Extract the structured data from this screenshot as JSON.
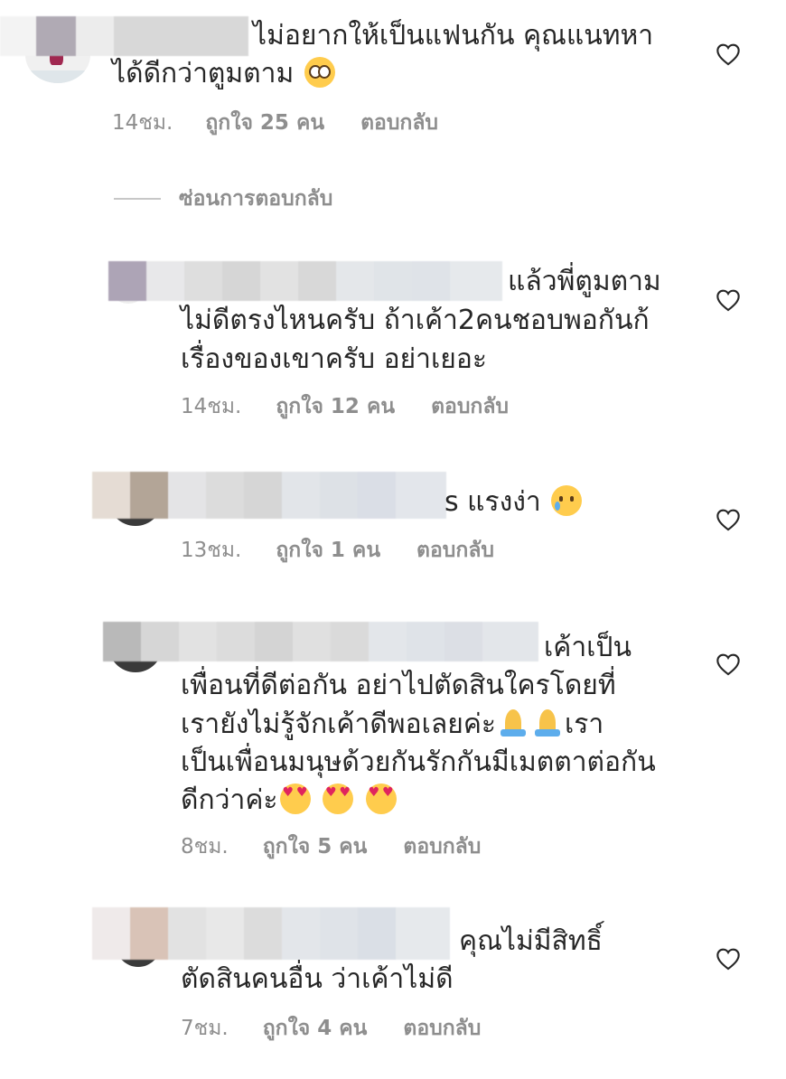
{
  "ui": {
    "likes_word": "ถูกใจ",
    "people_word": "คน",
    "reply_label": "ตอบกลับ",
    "hide_replies_label": "ซ่อนการตอบกลับ"
  },
  "comments": [
    {
      "line1": "ไม่อยากให้เป็นแฟนกัน คุณแนทหา",
      "line2": "ได้ดีกว่าตูมตาม",
      "emoji": "pleading-face",
      "time": "14ชม.",
      "likes": "ถูกใจ 25 คน",
      "reply": "ตอบกลับ"
    },
    {
      "line1": "แล้วพี่ตูมตาม",
      "line2": "ไม่ดีตรงไหนครับ ถ้าเค้า2คนชอบพอกันก้",
      "line3": "เรื่องของเขาครับ อย่าเยอะ",
      "time": "14ชม.",
      "likes": "ถูกใจ 12 คน",
      "reply": "ตอบกลับ"
    },
    {
      "line1": "s แรงง่า",
      "emoji": "crying-face",
      "time": "13ชม.",
      "likes": "ถูกใจ 1 คน",
      "reply": "ตอบกลับ"
    },
    {
      "line1": "เค้าเป็น",
      "line2": "เพื่อนที่ดีต่อกัน อย่าไปตัดสินใครโดยที่",
      "line3a": "เรายังไม่รู้จักเค้าดีพอเลยค่ะ",
      "line3b": "เรา",
      "line4": "เป็นเพื่อนมนุษด้วยกันรักกันมีเมตตาต่อกัน",
      "line5": "ดีกว่าค่ะ",
      "emoji_a": "folded-hands",
      "emoji_b": "smiling-face-with-heart-eyes",
      "time": "8ชม.",
      "likes": "ถูกใจ 5 คน",
      "reply": "ตอบกลับ"
    },
    {
      "line1": "คุณไม่มีสิทธิ์",
      "line2": "ตัดสินคนอื่น ว่าเค้าไม่ดี",
      "time": "7ชม.",
      "likes": "ถูกใจ 4 คน",
      "reply": "ตอบกลับ"
    }
  ],
  "icons": {
    "like": "heart-outline-icon"
  },
  "colors": {
    "text": "#262626",
    "meta": "#8e8e8e",
    "divider": "#c7c7c7"
  }
}
